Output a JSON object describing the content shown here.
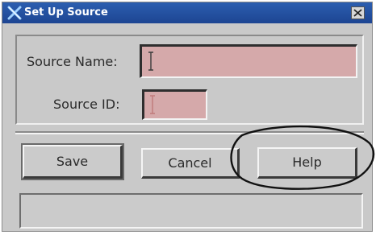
{
  "window": {
    "title": "Set Up Source",
    "title_icon": "x-logo-icon",
    "close_icon": "close-icon",
    "titlebar_color": "#1f4b9b"
  },
  "form": {
    "source_name": {
      "label": "Source Name:",
      "value": ""
    },
    "source_id": {
      "label": "Source ID:",
      "value": ""
    },
    "field_color": "#d5a9aa"
  },
  "buttons": {
    "save_label": "Save",
    "cancel_label": "Cancel",
    "help_label": "Help"
  },
  "status": {
    "text": ""
  },
  "annotation": {
    "type": "hand-drawn ellipse",
    "target": "help-button",
    "color": "#000000"
  }
}
